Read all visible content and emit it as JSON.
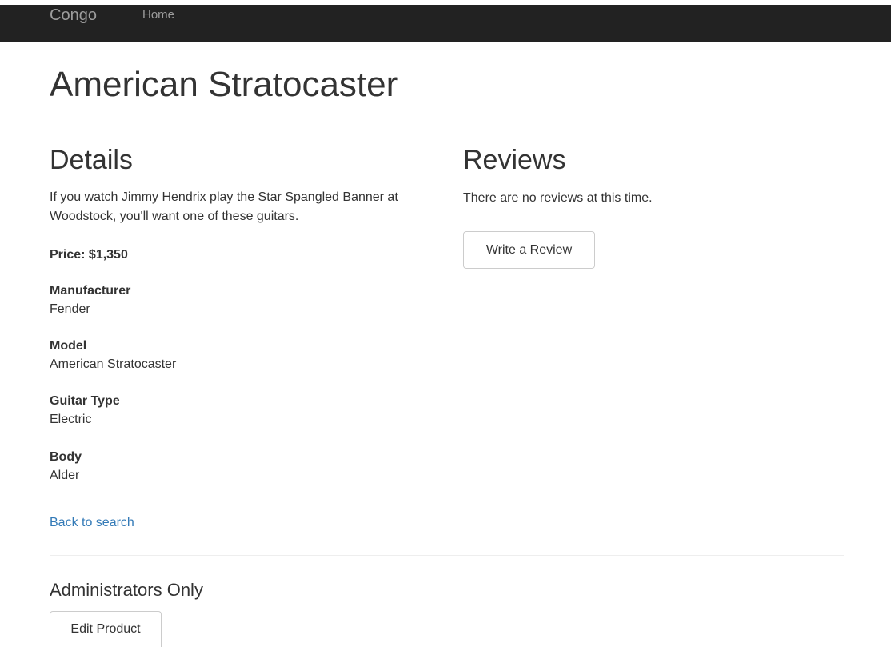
{
  "navbar": {
    "brand": "Congo",
    "home_label": "Home"
  },
  "product": {
    "title": "American Stratocaster",
    "details_heading": "Details",
    "description": "If you watch Jimmy Hendrix play the Star Spangled Banner at Woodstock, you'll want one of these guitars.",
    "price_label": "Price: $1,350",
    "specs": [
      {
        "label": "Manufacturer",
        "value": "Fender"
      },
      {
        "label": "Model",
        "value": "American Stratocaster"
      },
      {
        "label": "Guitar Type",
        "value": "Electric"
      },
      {
        "label": "Body",
        "value": "Alder"
      }
    ],
    "back_link": "Back to search"
  },
  "reviews": {
    "heading": "Reviews",
    "empty_message": "There are no reviews at this time.",
    "write_button": "Write a Review"
  },
  "admin": {
    "heading": "Administrators Only",
    "edit_button": "Edit Product"
  },
  "colors": {
    "navbar_bg": "#222222",
    "link": "#337ab7",
    "text": "#333333"
  }
}
